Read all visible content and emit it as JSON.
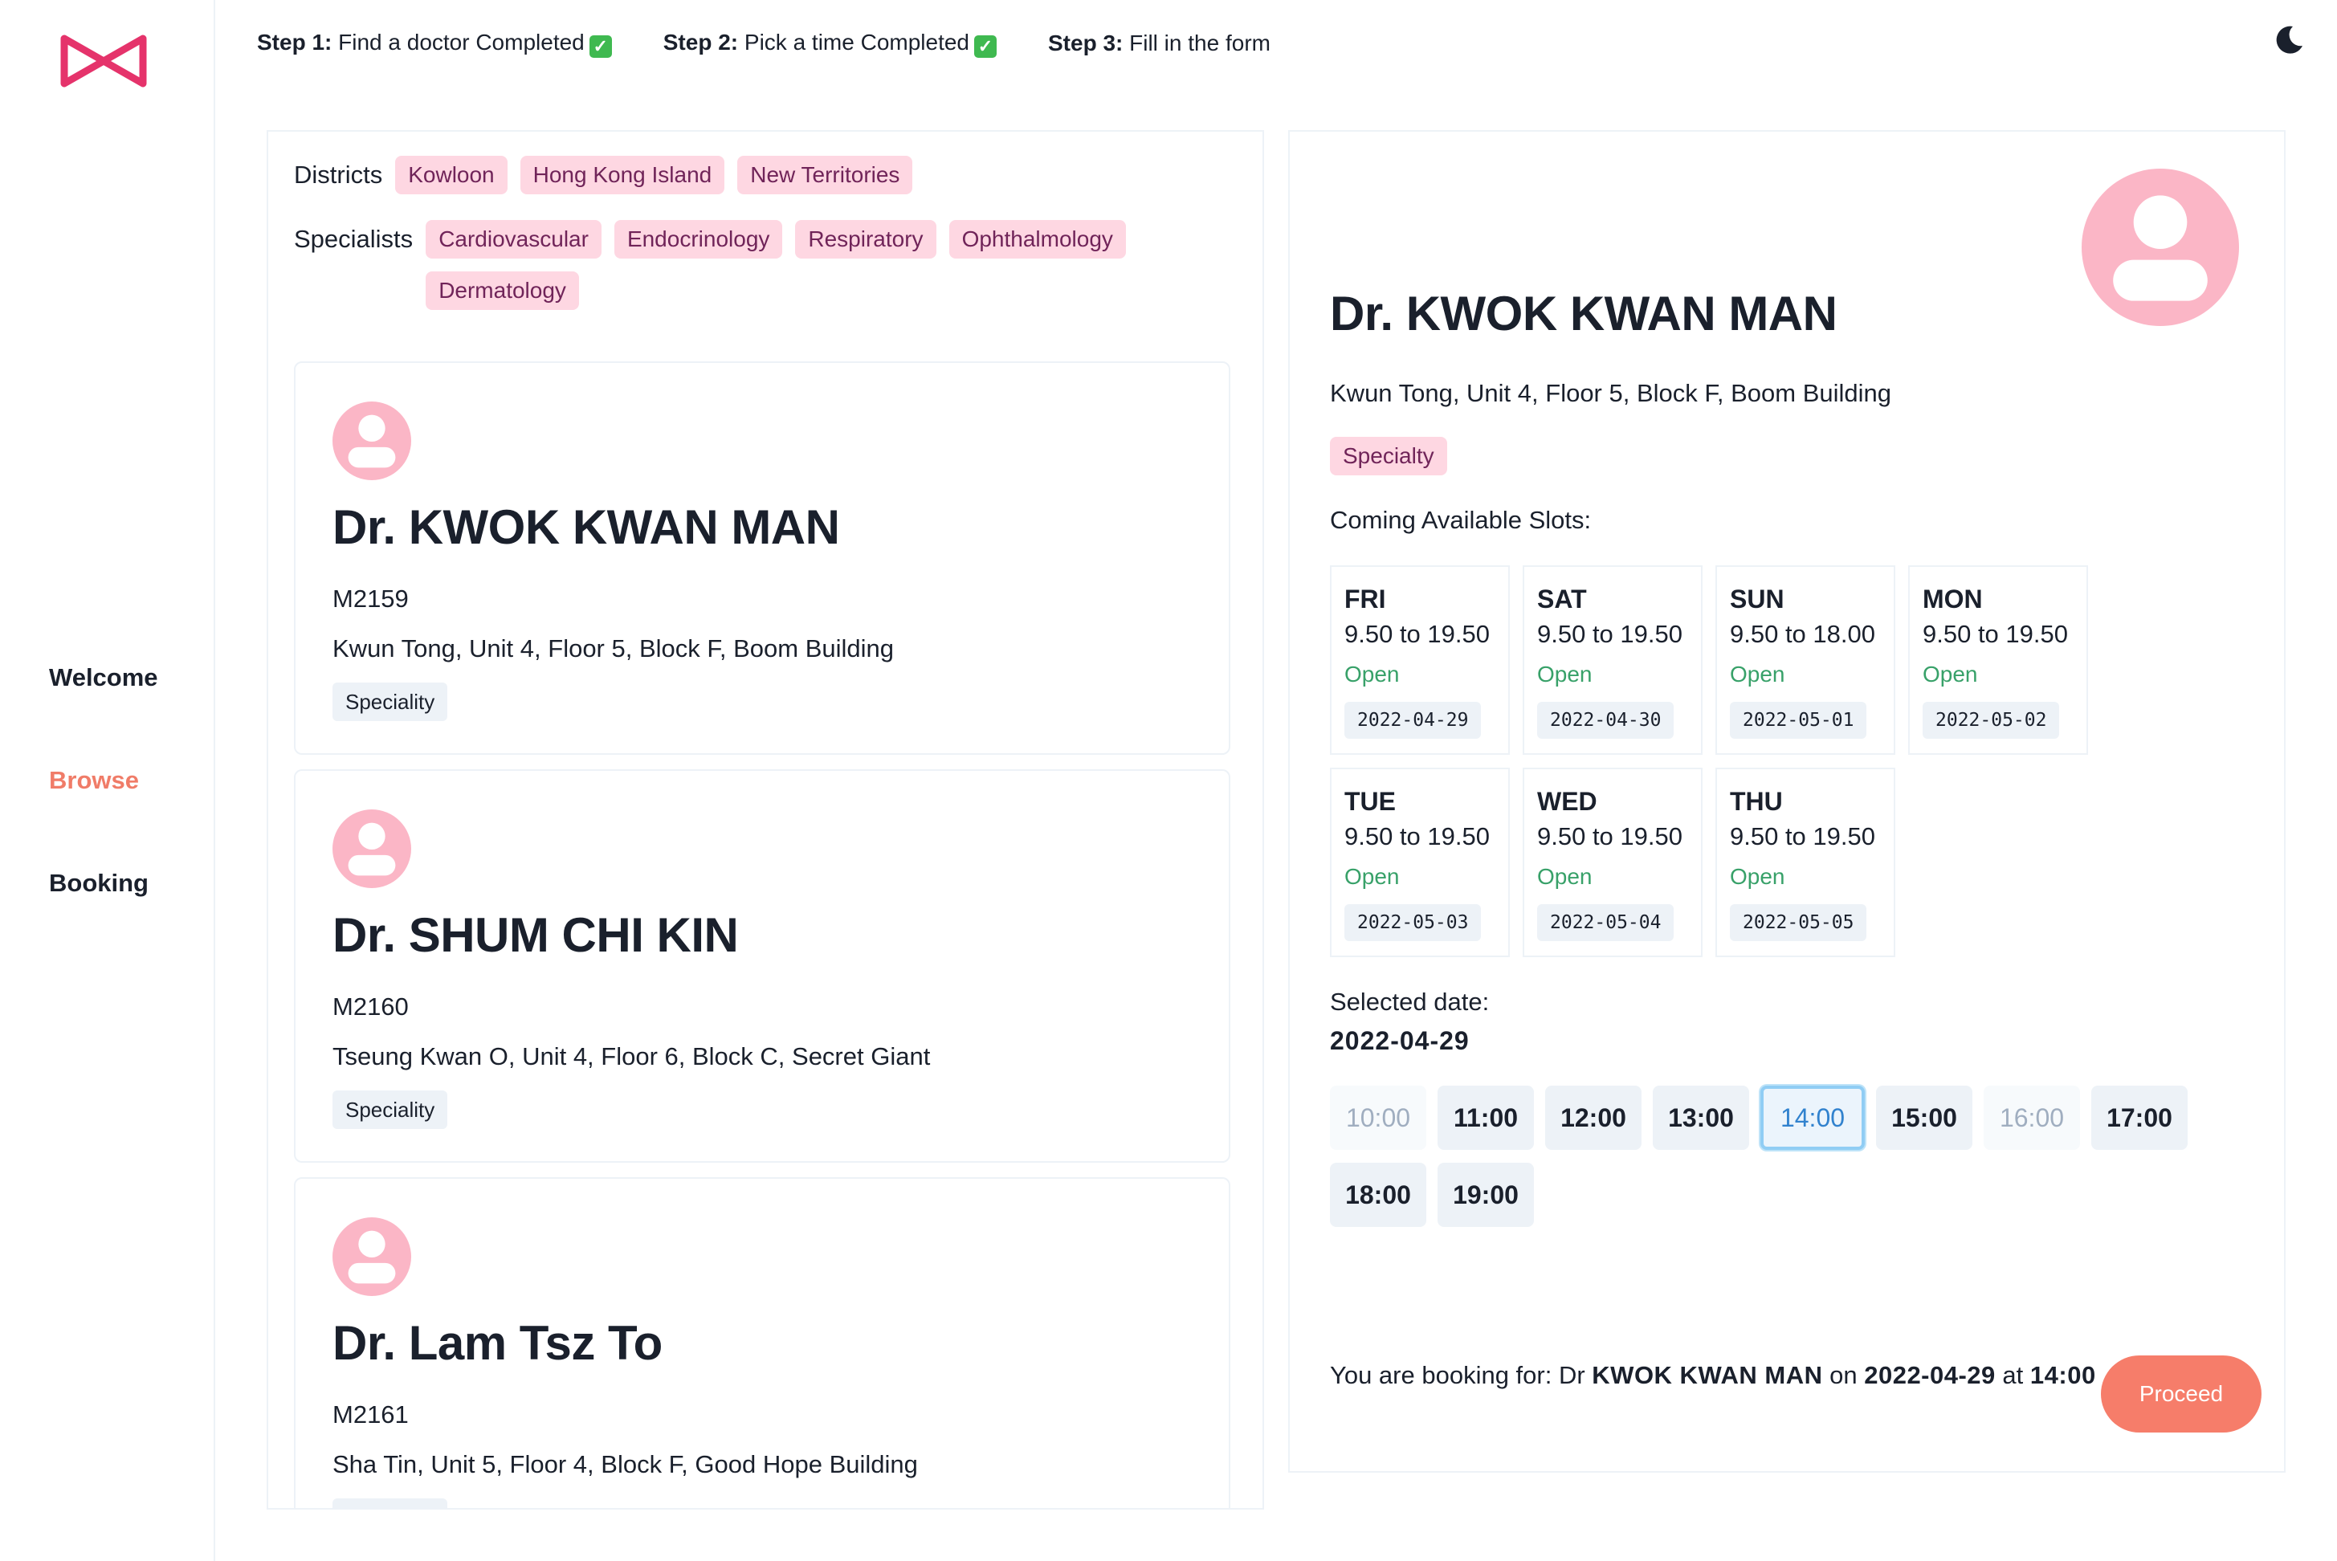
{
  "sidebar": {
    "logo": "bow-logo",
    "nav": [
      {
        "label": "Welcome",
        "active": false
      },
      {
        "label": "Browse",
        "active": true
      },
      {
        "label": "Booking",
        "active": false
      }
    ]
  },
  "steps": [
    {
      "num": "Step 1:",
      "text": "Find a doctor Completed",
      "done": true
    },
    {
      "num": "Step 2:",
      "text": "Pick a time Completed",
      "done": true
    },
    {
      "num": "Step 3:",
      "text": "Fill in the form",
      "done": false
    }
  ],
  "theme_toggle_icon": "moon-icon",
  "filters": {
    "districts_label": "Districts",
    "districts": [
      "Kowloon",
      "Hong Kong Island",
      "New Territories"
    ],
    "specialists_label": "Specialists",
    "specialists": [
      "Cardiovascular",
      "Endocrinology",
      "Respiratory",
      "Ophthalmology",
      "Dermatology"
    ]
  },
  "doctors": [
    {
      "name": "Dr. KWOK KWAN MAN",
      "code": "M2159",
      "address": "Kwun Tong, Unit 4, Floor 5, Block F, Boom Building",
      "speciality": "Speciality"
    },
    {
      "name": "Dr. SHUM CHI KIN",
      "code": "M2160",
      "address": "Tseung Kwan O, Unit 4, Floor 6, Block C, Secret Giant",
      "speciality": "Speciality"
    },
    {
      "name": "Dr. Lam Tsz To",
      "code": "M2161",
      "address": "Sha Tin, Unit 5, Floor 4, Block F, Good Hope Building",
      "speciality": "Speciality"
    }
  ],
  "selected": {
    "name": "Dr. KWOK KWAN MAN",
    "address": "Kwun Tong, Unit 4, Floor 5, Block F, Boom Building",
    "specialty": "Specialty",
    "slots_heading": "Coming Available Slots:",
    "days": [
      {
        "day": "FRI",
        "hours": "9.50 to 19.50",
        "status": "Open",
        "date": "2022-04-29"
      },
      {
        "day": "SAT",
        "hours": "9.50 to 19.50",
        "status": "Open",
        "date": "2022-04-30"
      },
      {
        "day": "SUN",
        "hours": "9.50 to 18.00",
        "status": "Open",
        "date": "2022-05-01"
      },
      {
        "day": "MON",
        "hours": "9.50 to 19.50",
        "status": "Open",
        "date": "2022-05-02"
      },
      {
        "day": "TUE",
        "hours": "9.50 to 19.50",
        "status": "Open",
        "date": "2022-05-03"
      },
      {
        "day": "WED",
        "hours": "9.50 to 19.50",
        "status": "Open",
        "date": "2022-05-04"
      },
      {
        "day": "THU",
        "hours": "9.50 to 19.50",
        "status": "Open",
        "date": "2022-05-05"
      }
    ],
    "selected_date_label": "Selected date:",
    "selected_date": "2022-04-29",
    "times": [
      {
        "time": "10:00",
        "state": "disabled"
      },
      {
        "time": "11:00",
        "state": "available"
      },
      {
        "time": "12:00",
        "state": "available"
      },
      {
        "time": "13:00",
        "state": "available"
      },
      {
        "time": "14:00",
        "state": "selected"
      },
      {
        "time": "15:00",
        "state": "available"
      },
      {
        "time": "16:00",
        "state": "disabled"
      },
      {
        "time": "17:00",
        "state": "available"
      },
      {
        "time": "18:00",
        "state": "available"
      },
      {
        "time": "19:00",
        "state": "available"
      }
    ]
  },
  "summary": {
    "prefix": "You are booking for: Dr",
    "doctor": "KWOK KWAN MAN",
    "on": "on",
    "date": "2022-04-29",
    "at": "at",
    "time": "14:00"
  },
  "proceed_label": "Proceed",
  "colors": {
    "accent": "#f07c68",
    "tag_bg": "#fed7e2",
    "tag_text": "#702459",
    "open_green": "#38a169",
    "selected_blue": "#3182ce",
    "proceed_bg": "#f67d6a"
  }
}
